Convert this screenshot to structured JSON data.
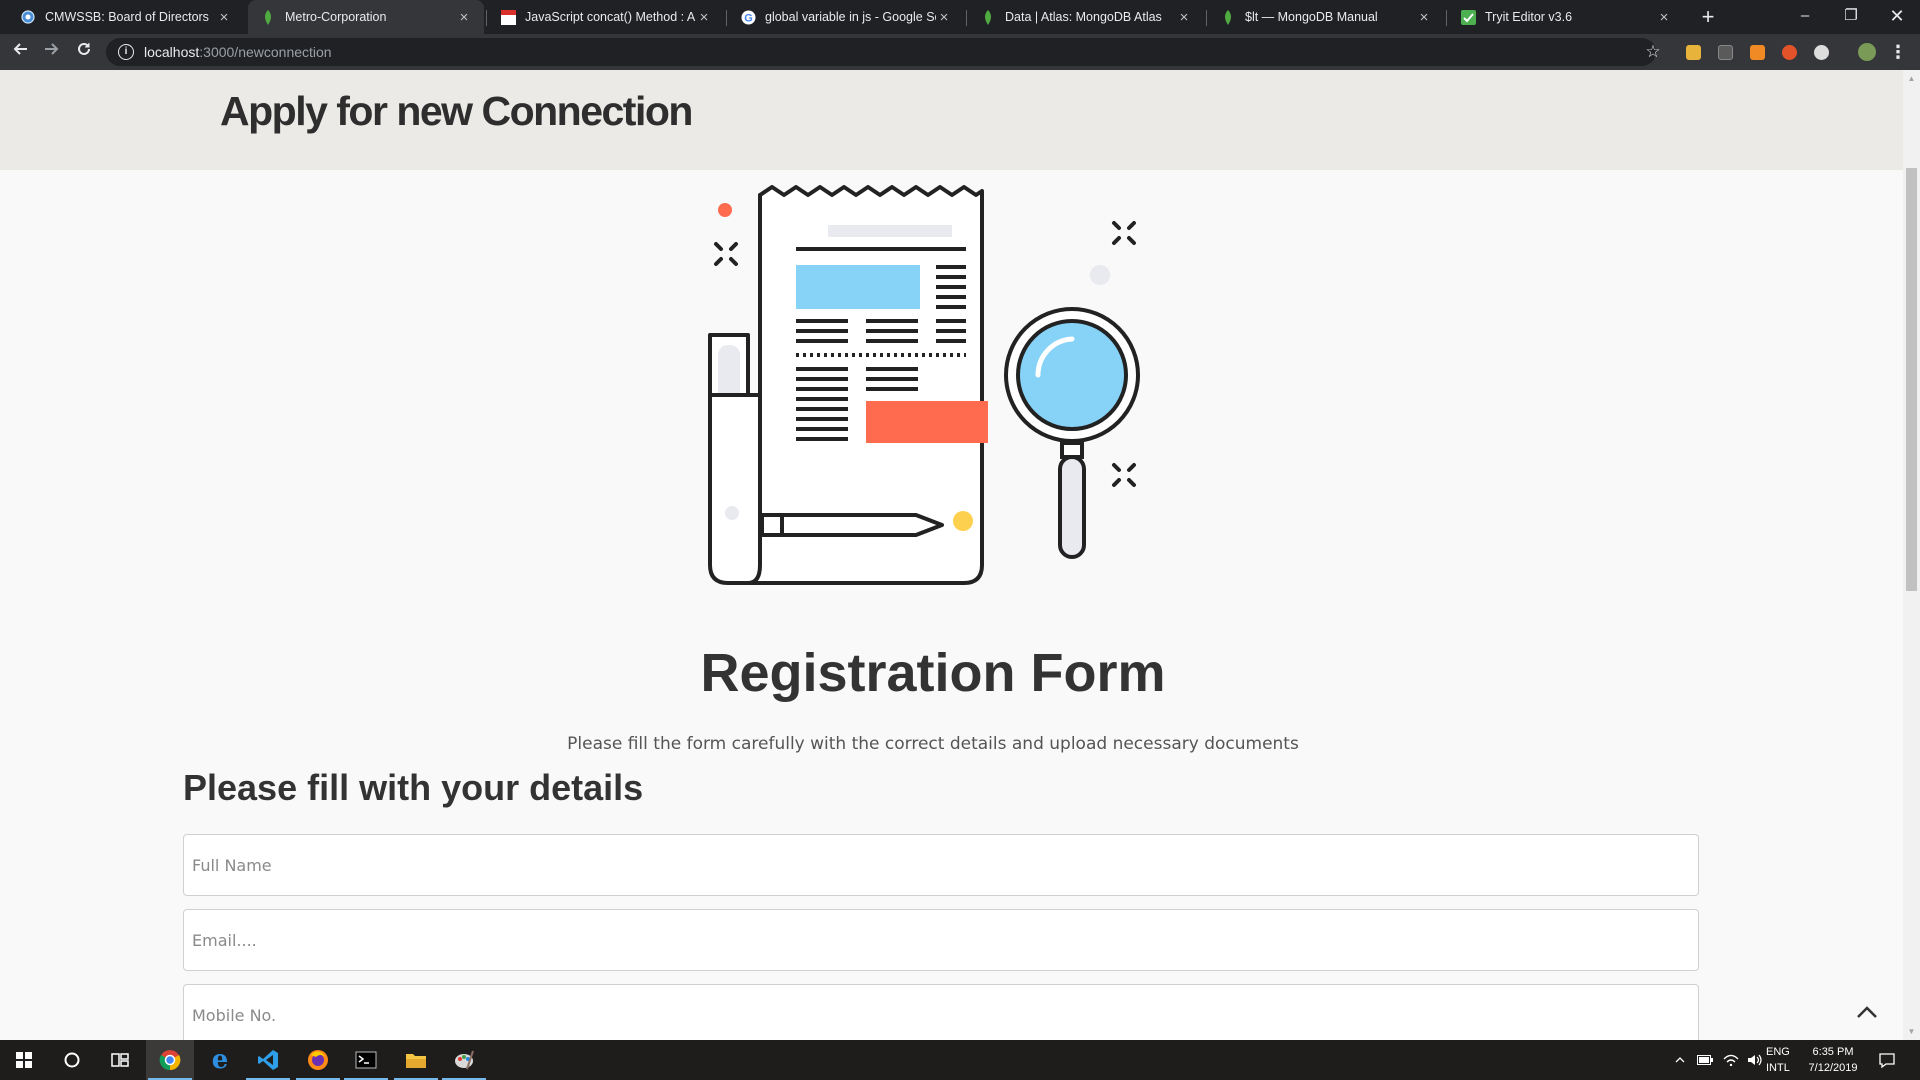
{
  "browser": {
    "tabs": [
      {
        "title": "CMWSSB: Board of Directors",
        "active": false,
        "favicon": "globe-icon"
      },
      {
        "title": "Metro-Corporation",
        "active": true,
        "favicon": "mongodb-leaf-icon"
      },
      {
        "title": "JavaScript concat() Method : Arra",
        "active": false,
        "favicon": "w3-icon"
      },
      {
        "title": "global variable in js - Google Sea",
        "active": false,
        "favicon": "google-icon"
      },
      {
        "title": "Data | Atlas: MongoDB Atlas",
        "active": false,
        "favicon": "mongodb-leaf-icon"
      },
      {
        "title": "$lt — MongoDB Manual",
        "active": false,
        "favicon": "mongodb-leaf-icon"
      },
      {
        "title": "Tryit Editor v3.6",
        "active": false,
        "favicon": "tryit-icon"
      }
    ],
    "address": {
      "host": "localhost",
      "path": ":3000/newconnection"
    }
  },
  "page": {
    "header_title": "Apply for new Connection",
    "reg_title": "Registration Form",
    "reg_description": "Please fill the form carefully with the correct details and upload necessary documents",
    "details_heading": "Please fill with your details",
    "fields": {
      "full_name": {
        "placeholder": "Full Name",
        "value": ""
      },
      "email": {
        "placeholder": "Email....",
        "value": ""
      },
      "mobile": {
        "placeholder": "Mobile No.",
        "value": ""
      }
    }
  },
  "taskbar": {
    "apps": [
      "windows-start-icon",
      "cortana-search-icon",
      "task-view-icon",
      "chrome-icon",
      "edge-icon",
      "vscode-icon",
      "firefox-icon",
      "terminal-icon",
      "file-explorer-icon",
      "paint-icon"
    ],
    "language_line1": "ENG",
    "language_line2": "INTL",
    "time": "6:35 PM",
    "date": "7/12/2019"
  },
  "colors": {
    "tab_bar": "#202124",
    "toolbar": "#35363a",
    "page_header_bg": "#ebeae7",
    "illustration_blue": "#86d3f7",
    "illustration_red": "#fe6b4e",
    "illustration_yellow": "#fed04f"
  }
}
